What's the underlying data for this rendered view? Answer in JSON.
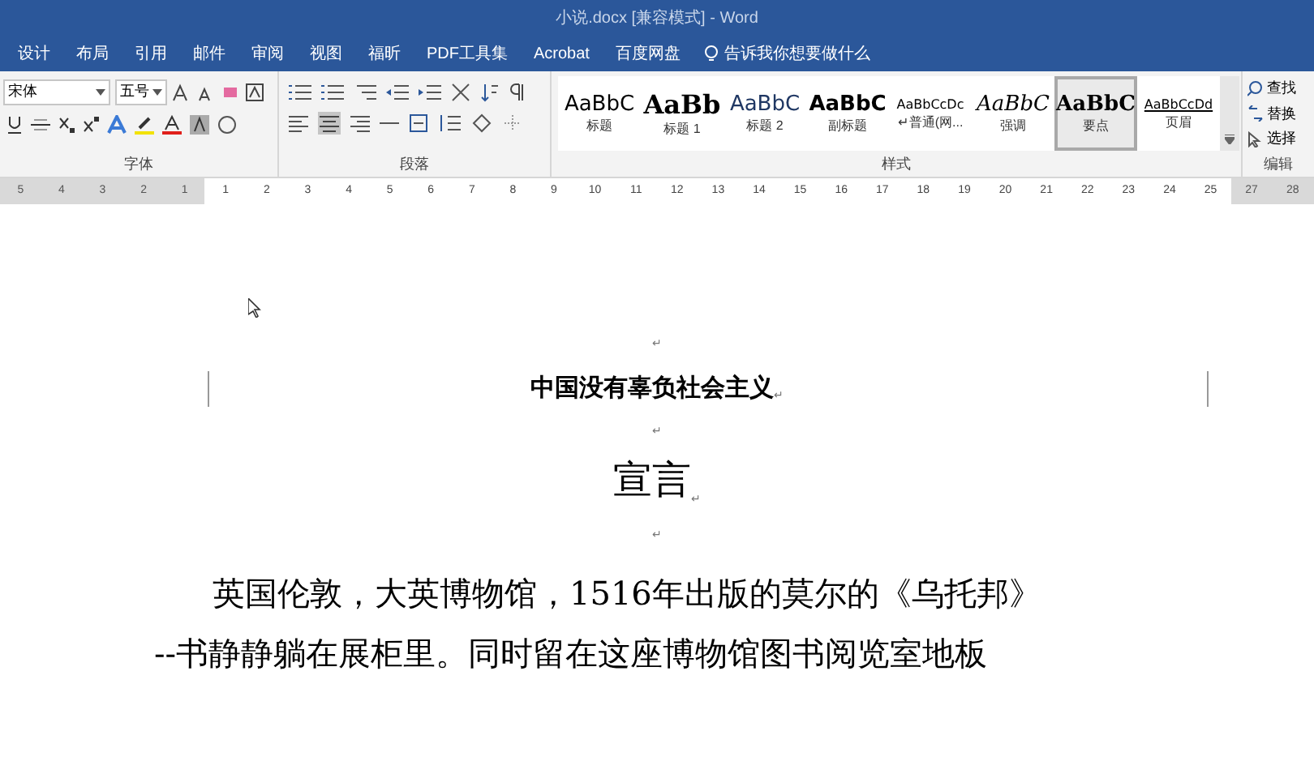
{
  "window": {
    "title": "小说.docx [兼容模式] - Word"
  },
  "tabs": [
    {
      "label": "设计",
      "selected": false
    },
    {
      "label": "布局",
      "selected": false
    },
    {
      "label": "引用",
      "selected": false
    },
    {
      "label": "邮件",
      "selected": false
    },
    {
      "label": "审阅",
      "selected": false
    },
    {
      "label": "视图",
      "selected": false
    },
    {
      "label": "福昕",
      "selected": false
    },
    {
      "label": "PDF工具集",
      "selected": false
    },
    {
      "label": "Acrobat",
      "selected": false
    },
    {
      "label": "百度网盘",
      "selected": false
    }
  ],
  "tell_me": {
    "placeholder": "告诉我你想要做什么"
  },
  "font": {
    "family": "宋体",
    "size": "五号",
    "group_label": "字体"
  },
  "paragraph": {
    "group_label": "段落"
  },
  "styles": {
    "group_label": "样式",
    "items": [
      {
        "sample": "AaBbC",
        "label": "标题",
        "selected": false
      },
      {
        "sample": "AaBb",
        "label": "标题 1",
        "selected": false
      },
      {
        "sample": "AaBbC",
        "label": "标题 2",
        "selected": false
      },
      {
        "sample": "AaBbC",
        "label": "副标题",
        "selected": false
      },
      {
        "sample": "AaBbCcDc",
        "label": "↵普通(网...",
        "selected": false
      },
      {
        "sample": "AaBbC",
        "label": "强调",
        "selected": false
      },
      {
        "sample": "AaBbC",
        "label": "要点",
        "selected": true
      },
      {
        "sample": "AaBbCcDd",
        "label": "页眉",
        "selected": false
      }
    ]
  },
  "editing": {
    "group_label": "编辑",
    "items": [
      "查找",
      "替换",
      "选择"
    ]
  },
  "ruler": [
    {
      "label": "5",
      "kind": "margin"
    },
    {
      "label": "4",
      "kind": "margin"
    },
    {
      "label": "3",
      "kind": "margin"
    },
    {
      "label": "2",
      "kind": "margin"
    },
    {
      "label": "1",
      "kind": "margin"
    },
    {
      "label": "1",
      "kind": "page"
    },
    {
      "label": "2",
      "kind": "page"
    },
    {
      "label": "3",
      "kind": "page"
    },
    {
      "label": "4",
      "kind": "page"
    },
    {
      "label": "5",
      "kind": "page"
    },
    {
      "label": "6",
      "kind": "page"
    },
    {
      "label": "7",
      "kind": "page"
    },
    {
      "label": "8",
      "kind": "page"
    },
    {
      "label": "9",
      "kind": "page"
    },
    {
      "label": "10",
      "kind": "page"
    },
    {
      "label": "11",
      "kind": "page"
    },
    {
      "label": "12",
      "kind": "page"
    },
    {
      "label": "13",
      "kind": "page"
    },
    {
      "label": "14",
      "kind": "page"
    },
    {
      "label": "15",
      "kind": "page"
    },
    {
      "label": "16",
      "kind": "page"
    },
    {
      "label": "17",
      "kind": "page"
    },
    {
      "label": "18",
      "kind": "page"
    },
    {
      "label": "19",
      "kind": "page"
    },
    {
      "label": "20",
      "kind": "page"
    },
    {
      "label": "21",
      "kind": "page"
    },
    {
      "label": "22",
      "kind": "page"
    },
    {
      "label": "23",
      "kind": "page"
    },
    {
      "label": "24",
      "kind": "page"
    },
    {
      "label": "25",
      "kind": "page"
    },
    {
      "label": "27",
      "kind": "margin"
    },
    {
      "label": "28",
      "kind": "margin"
    }
  ],
  "document": {
    "paragraphs": [
      {
        "kind": "empty",
        "mark": "↵"
      },
      {
        "kind": "subtitle",
        "text": "中国没有辜负社会主义",
        "mark": "↵"
      },
      {
        "kind": "empty",
        "mark": "↵"
      },
      {
        "kind": "title",
        "text": "宣言",
        "mark": "↵"
      },
      {
        "kind": "empty",
        "mark": "↵"
      },
      {
        "kind": "body",
        "lines": [
          "英国伦敦，大英博物馆，1516年出版的莫尔的《乌托邦》",
          "--书静静躺在展柜里。同时留在这座博物馆图书阅览室地板"
        ]
      }
    ]
  }
}
